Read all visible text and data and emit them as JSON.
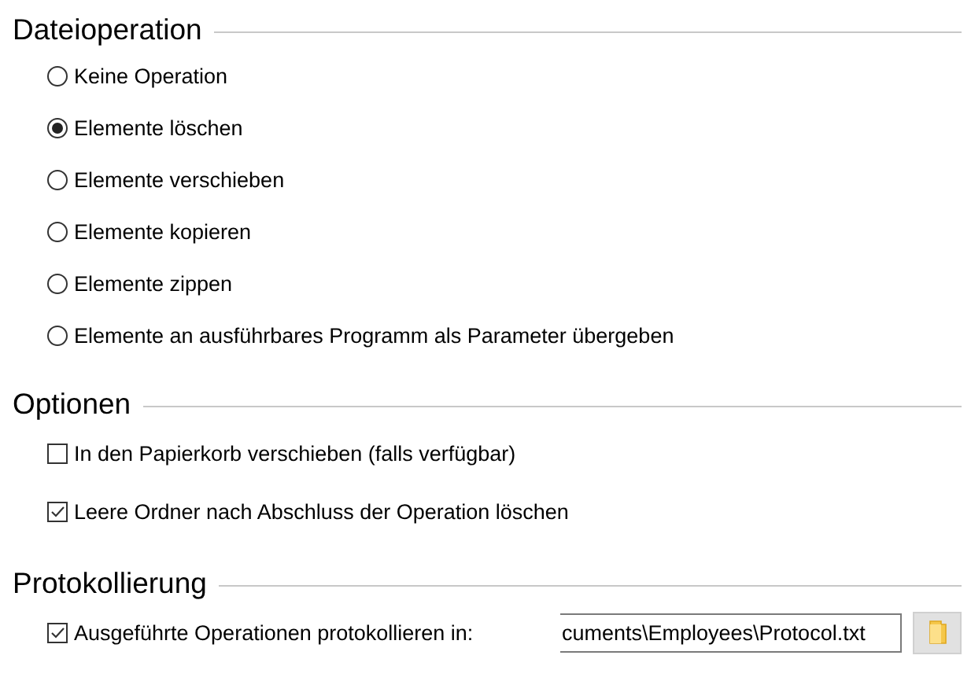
{
  "sections": [
    {
      "title": "Dateioperation",
      "kind": "radio",
      "items": [
        {
          "label": "Keine Operation",
          "selected": false
        },
        {
          "label": "Elemente löschen",
          "selected": true
        },
        {
          "label": "Elemente verschieben",
          "selected": false
        },
        {
          "label": "Elemente kopieren",
          "selected": false
        },
        {
          "label": "Elemente zippen",
          "selected": false
        },
        {
          "label": "Elemente an ausführbares Programm als Parameter übergeben",
          "selected": false
        }
      ]
    },
    {
      "title": "Optionen",
      "kind": "check",
      "items": [
        {
          "label": "In den Papierkorb verschieben (falls verfügbar)",
          "checked": false
        },
        {
          "label": "Leere Ordner nach Abschluss der Operation löschen",
          "checked": true
        }
      ]
    },
    {
      "title": "Protokollierung",
      "kind": "log",
      "items": [
        {
          "label": "Ausgeführte Operationen protokollieren in:",
          "checked": true,
          "value": "cuments\\Employees\\Protocol.txt"
        }
      ]
    }
  ]
}
